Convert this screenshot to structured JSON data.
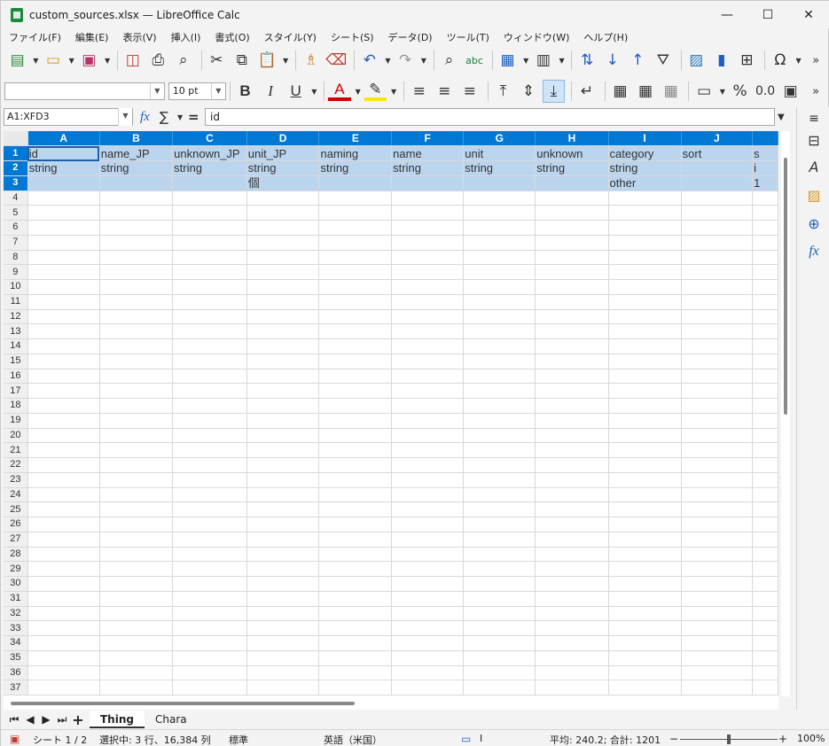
{
  "window": {
    "title": "custom_sources.xlsx — LibreOffice Calc",
    "minimize": "—",
    "maximize": "☐",
    "close": "✕"
  },
  "menu": [
    "ファイル(F)",
    "編集(E)",
    "表示(V)",
    "挿入(I)",
    "書式(O)",
    "スタイル(Y)",
    "シート(S)",
    "データ(D)",
    "ツール(T)",
    "ウィンドウ(W)",
    "ヘルプ(H)"
  ],
  "format": {
    "font_name": "",
    "font_size": "10 pt",
    "bold": "B",
    "italic": "I",
    "underline": "U",
    "font_color_label": "A",
    "percent": "%",
    "decimal": "0.0"
  },
  "formula_bar": {
    "name_box": "A1:XFD3",
    "content": "id",
    "fx": "fx",
    "sum": "∑",
    "equals": "="
  },
  "columns": [
    "A",
    "B",
    "C",
    "D",
    "E",
    "F",
    "G",
    "H",
    "I",
    "J"
  ],
  "rows": [
    [
      "id",
      "name_JP",
      "unknown_JP",
      "unit_JP",
      "naming",
      "name",
      "unit",
      "unknown",
      "category",
      "sort",
      "s"
    ],
    [
      "string",
      "string",
      "string",
      "string",
      "string",
      "string",
      "string",
      "string",
      "string",
      "",
      "i"
    ],
    [
      "",
      "",
      "",
      "個",
      "",
      "",
      "",
      "",
      "other",
      "",
      "1"
    ]
  ],
  "row_numbers": [
    "1",
    "2",
    "3",
    "4",
    "5",
    "6",
    "7",
    "8",
    "9",
    "10",
    "11",
    "12",
    "13",
    "14",
    "15",
    "16",
    "17",
    "18",
    "19",
    "20",
    "21",
    "22",
    "23",
    "24",
    "25",
    "26",
    "27",
    "28",
    "29",
    "30",
    "31",
    "32",
    "33",
    "34",
    "35",
    "36",
    "37"
  ],
  "sheet_tabs": [
    "Thing",
    "Chara"
  ],
  "active_sheet": "Thing",
  "status": {
    "sheet": "シート 1 / 2",
    "selection": "選択中: 3 行、16,384 列",
    "page_style": "標準",
    "language": "英語（米国）",
    "sum": "平均: 240.2; 合計: 1201",
    "zoom": "100%"
  }
}
